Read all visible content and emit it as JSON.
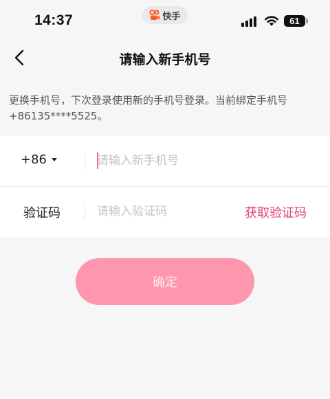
{
  "status_bar": {
    "time": "14:37",
    "app_name": "快手",
    "battery": "61",
    "icons": [
      "cellular-signal-icon",
      "wifi-icon",
      "battery-icon"
    ]
  },
  "header": {
    "back_icon": "chevron-left-icon",
    "title": "请输入新手机号"
  },
  "description": "更换手机号，下次登录使用新的手机号登录。当前绑定手机号+86135****5525。",
  "form": {
    "country_code": "+86",
    "phone_placeholder": "请输入新手机号",
    "phone_value": "",
    "code_label": "验证码",
    "code_placeholder": "请输入验证码",
    "code_value": "",
    "get_code_label": "获取验证码"
  },
  "confirm_label": "确定",
  "colors": {
    "accent": "#e0457a",
    "button_disabled": "#fe97ad",
    "background": "#f6f5f7"
  }
}
